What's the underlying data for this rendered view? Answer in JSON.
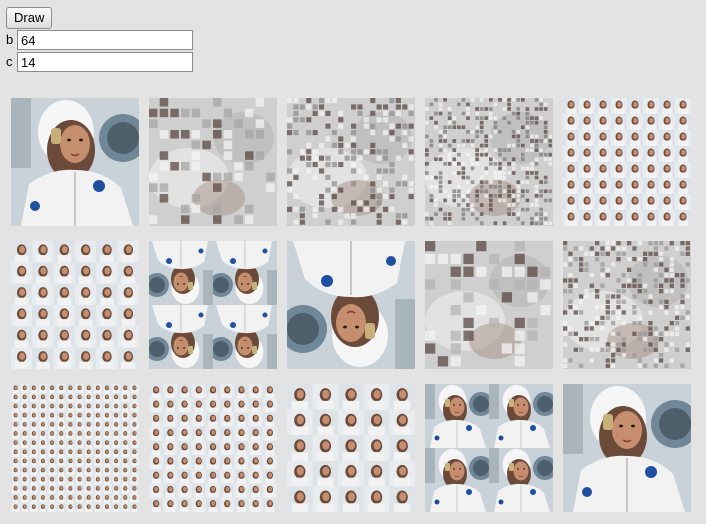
{
  "controls": {
    "draw_label": "Draw",
    "b": {
      "label": "b",
      "value": "64"
    },
    "c": {
      "label": "c",
      "value": "14"
    }
  },
  "tiles": [
    {
      "name": "tile-1",
      "kind": "photo",
      "reps": 1
    },
    {
      "name": "tile-2",
      "kind": "noise",
      "density": 6,
      "tint": "#a6a6a6"
    },
    {
      "name": "tile-3",
      "kind": "noise",
      "density": 10,
      "tint": "#8f8f8f"
    },
    {
      "name": "tile-4",
      "kind": "noise",
      "density": 14,
      "tint": "#7e7e7e"
    },
    {
      "name": "tile-5",
      "kind": "mosaic",
      "reps": 8
    },
    {
      "name": "tile-6",
      "kind": "mosaic",
      "reps": 6
    },
    {
      "name": "tile-7",
      "kind": "photo",
      "reps": 2,
      "rotate": 180
    },
    {
      "name": "tile-8",
      "kind": "photo",
      "reps": 1,
      "rotate": 180
    },
    {
      "name": "tile-9",
      "kind": "noise",
      "density": 5,
      "tint": "#b4b4b4"
    },
    {
      "name": "tile-10",
      "kind": "noise",
      "density": 12,
      "tint": "#9a9a9a"
    },
    {
      "name": "tile-11",
      "kind": "mosaic",
      "reps": 14
    },
    {
      "name": "tile-12",
      "kind": "mosaic",
      "reps": 9
    },
    {
      "name": "tile-13",
      "kind": "mosaic",
      "reps": 5
    },
    {
      "name": "tile-14",
      "kind": "photo",
      "reps": 2
    },
    {
      "name": "tile-15",
      "kind": "photo",
      "reps": 1
    }
  ],
  "colors": {
    "page_bg": "#e3e3e3",
    "suit": "#f2f2f2",
    "hair": "#6b4a3a",
    "skin": "#c58f6f",
    "window": "#6f8796",
    "cabin": "#c9d2d8",
    "patch": "#1f4fa0"
  }
}
